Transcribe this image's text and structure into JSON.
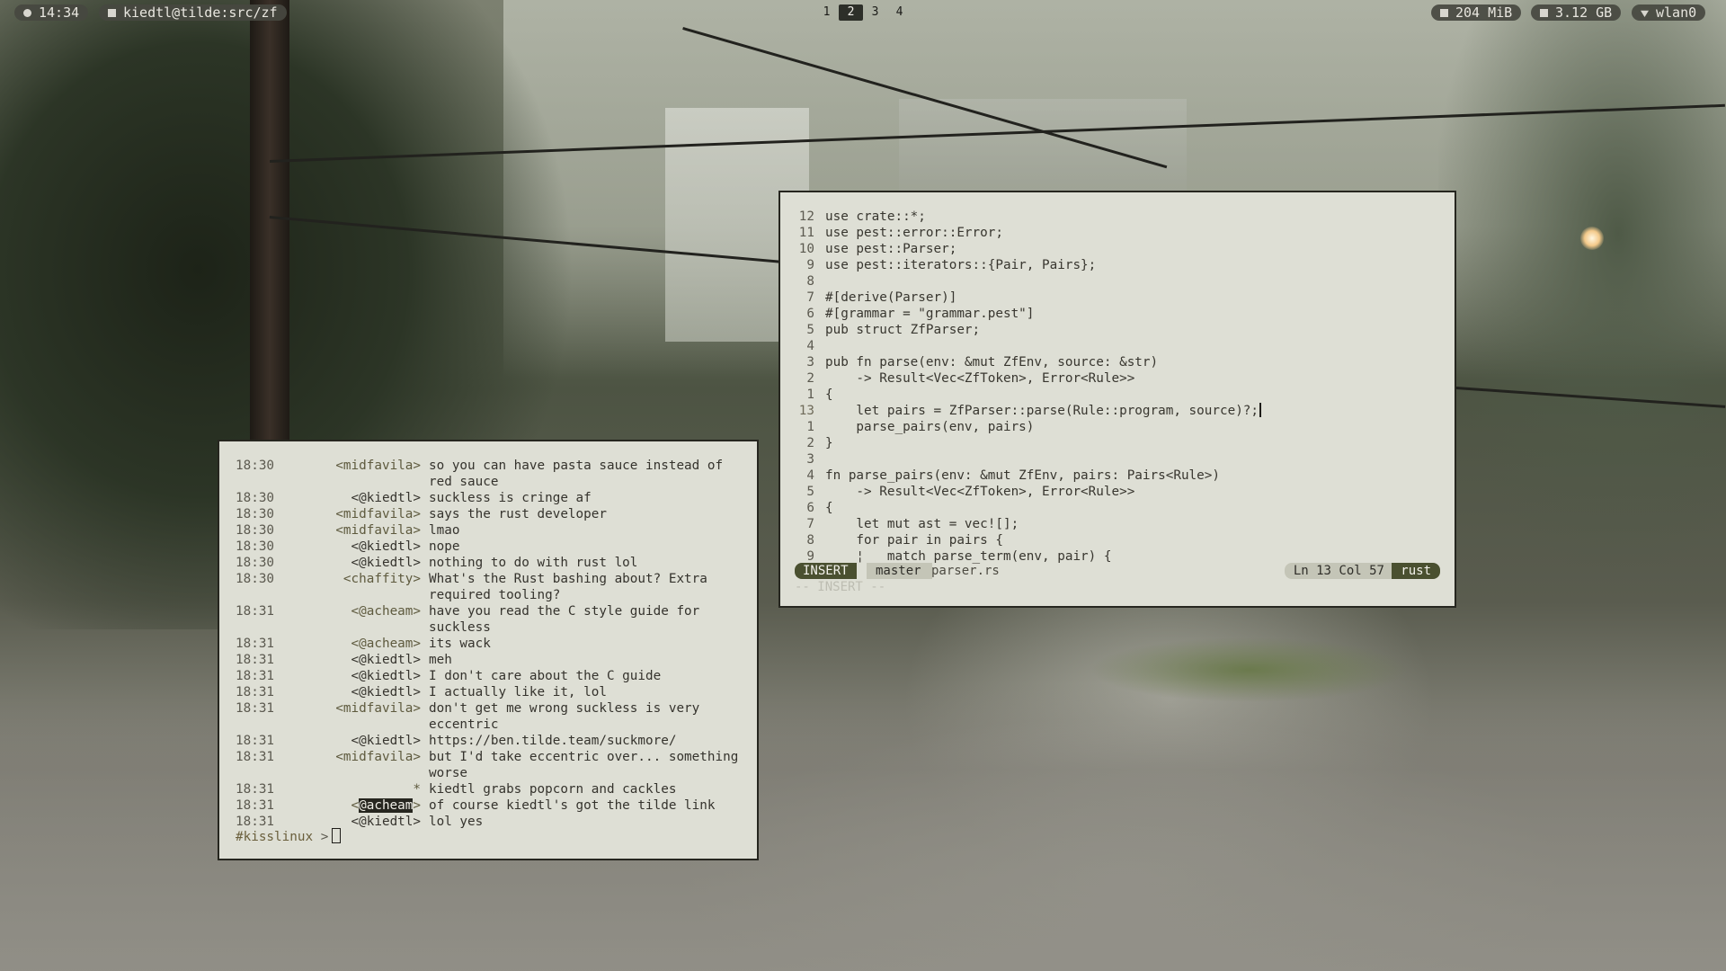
{
  "topbar": {
    "clock": "14:34",
    "window_title": "kiedtl@tilde:src/zf",
    "workspaces": [
      "1",
      "2",
      "3",
      "4"
    ],
    "active_workspace": "2",
    "memory": "204 MiB",
    "disk": "3.12 GB",
    "network": "wlan0",
    "icons": {
      "clock": "clock-icon",
      "title": "terminal-icon",
      "memory": "memory-icon",
      "disk": "disk-icon",
      "network": "wifi-icon"
    }
  },
  "editor": {
    "lines": [
      {
        "n": "12",
        "code": "use crate::*;"
      },
      {
        "n": "11",
        "code": "use pest::error::Error;"
      },
      {
        "n": "10",
        "code": "use pest::Parser;"
      },
      {
        "n": "9",
        "code": "use pest::iterators::{Pair, Pairs};"
      },
      {
        "n": "8",
        "code": ""
      },
      {
        "n": "7",
        "code": "#[derive(Parser)]"
      },
      {
        "n": "6",
        "code": "#[grammar = \"grammar.pest\"]"
      },
      {
        "n": "5",
        "code": "pub struct ZfParser;"
      },
      {
        "n": "4",
        "code": ""
      },
      {
        "n": "3",
        "code": "pub fn parse(env: &mut ZfEnv, source: &str)"
      },
      {
        "n": "2",
        "code": "    -> Result<Vec<ZfToken>, Error<Rule>>"
      },
      {
        "n": "1",
        "code": "{"
      },
      {
        "n": "13",
        "code": "    let pairs = ZfParser::parse(Rule::program, source)?;",
        "current": true
      },
      {
        "n": "1",
        "code": "    parse_pairs(env, pairs)"
      },
      {
        "n": "2",
        "code": "}"
      },
      {
        "n": "3",
        "code": ""
      },
      {
        "n": "4",
        "code": "fn parse_pairs(env: &mut ZfEnv, pairs: Pairs<Rule>)"
      },
      {
        "n": "5",
        "code": "    -> Result<Vec<ZfToken>, Error<Rule>>"
      },
      {
        "n": "6",
        "code": "{"
      },
      {
        "n": "7",
        "code": "    let mut ast = vec![];"
      },
      {
        "n": "8",
        "code": "    for pair in pairs {"
      },
      {
        "n": "9",
        "code": "    ¦   match parse_term(env, pair) {"
      }
    ],
    "status": {
      "mode": "INSERT",
      "branch": "master",
      "file": "parser.rs",
      "position": "Ln 13 Col 57",
      "language": "rust"
    },
    "cmdline": "-- INSERT --"
  },
  "irc": {
    "messages": [
      {
        "time": "18:30",
        "nick": "<midfavila>",
        "text": "so you can have pasta sauce instead of red sauce"
      },
      {
        "time": "18:30",
        "nick": "<@kiedtl>",
        "text": "suckless is cringe af",
        "me": true
      },
      {
        "time": "18:30",
        "nick": "<midfavila>",
        "text": "says the rust developer"
      },
      {
        "time": "18:30",
        "nick": "<midfavila>",
        "text": "lmao"
      },
      {
        "time": "18:30",
        "nick": "<@kiedtl>",
        "text": "nope",
        "me": true
      },
      {
        "time": "18:30",
        "nick": "<@kiedtl>",
        "text": "nothing to do with rust lol",
        "me": true
      },
      {
        "time": "18:30",
        "nick": "<chaffity>",
        "text": "What's the Rust bashing about? Extra required tooling?"
      },
      {
        "time": "18:31",
        "nick": "<@acheam>",
        "text": "have you read the C style guide for suckless"
      },
      {
        "time": "18:31",
        "nick": "<@acheam>",
        "text": "its wack"
      },
      {
        "time": "18:31",
        "nick": "<@kiedtl>",
        "text": "meh",
        "me": true
      },
      {
        "time": "18:31",
        "nick": "<@kiedtl>",
        "text": "I don't care about the C guide",
        "me": true
      },
      {
        "time": "18:31",
        "nick": "<@kiedtl>",
        "text": "I actually like it, lol",
        "me": true
      },
      {
        "time": "18:31",
        "nick": "<midfavila>",
        "text": "don't get me wrong suckless is very eccentric"
      },
      {
        "time": "18:31",
        "nick": "<@kiedtl>",
        "text": "https://ben.tilde.team/suckmore/",
        "me": true
      },
      {
        "time": "18:31",
        "nick": "<midfavila>",
        "text": "but I'd take eccentric over... something worse"
      },
      {
        "time": "18:31",
        "nick": "*",
        "text": "kiedtl grabs popcorn and cackles"
      },
      {
        "time": "18:31",
        "nick": "<@acheam>",
        "text": "of course kiedtl's got the tilde link",
        "highlight": "@acheam"
      },
      {
        "time": "18:31",
        "nick": "<@kiedtl>",
        "text": "lol yes",
        "me": true
      }
    ],
    "prompt_channel": "#kisslinux",
    "prompt_symbol": ">"
  }
}
